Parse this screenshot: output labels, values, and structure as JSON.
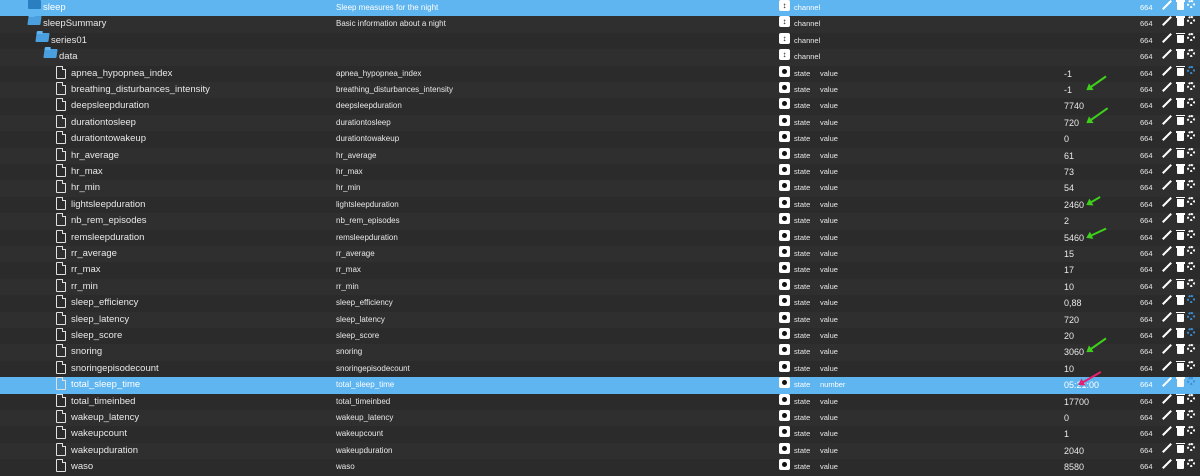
{
  "accent_color": "#5fb5f0",
  "annotation_colors": {
    "green": "#3ecf1a",
    "pink": "#e6206e"
  },
  "rows": [
    {
      "name": "sleep",
      "desc": "Sleep measures for the night",
      "role": "channel",
      "type": "",
      "common": "",
      "value": "",
      "acl": "664",
      "icon": "folder",
      "indent": 32,
      "selected": true
    },
    {
      "name": "sleepSummary",
      "desc": "Basic information about a night",
      "role": "channel",
      "type": "",
      "common": "",
      "value": "",
      "acl": "664",
      "icon": "folder-open",
      "indent": 32,
      "selected": false
    },
    {
      "name": "series01",
      "desc": "",
      "role": "channel",
      "type": "",
      "common": "",
      "value": "",
      "acl": "664",
      "icon": "folder-open",
      "indent": 40,
      "selected": false
    },
    {
      "name": "data",
      "desc": "",
      "role": "channel",
      "type": "",
      "common": "",
      "value": "",
      "acl": "664",
      "icon": "folder-open",
      "indent": 48,
      "selected": false
    },
    {
      "name": "apnea_hypopnea_index",
      "desc": "apnea_hypopnea_index",
      "role": "state",
      "type": "value",
      "common": "",
      "value": "-1",
      "acl": "664",
      "icon": "file",
      "indent": 56,
      "selected": false,
      "gear": "blue"
    },
    {
      "name": "breathing_disturbances_intensity",
      "desc": "breathing_disturbances_intensity",
      "role": "state",
      "type": "value",
      "common": "",
      "value": "-1",
      "acl": "664",
      "icon": "file",
      "indent": 56,
      "selected": false
    },
    {
      "name": "deepsleepduration",
      "desc": "deepsleepduration",
      "role": "state",
      "type": "value",
      "common": "",
      "value": "7740",
      "acl": "664",
      "icon": "file",
      "indent": 56,
      "selected": false
    },
    {
      "name": "durationtosleep",
      "desc": "durationtosleep",
      "role": "state",
      "type": "value",
      "common": "",
      "value": "720",
      "acl": "664",
      "icon": "file",
      "indent": 56,
      "selected": false
    },
    {
      "name": "durationtowakeup",
      "desc": "durationtowakeup",
      "role": "state",
      "type": "value",
      "common": "",
      "value": "0",
      "acl": "664",
      "icon": "file",
      "indent": 56,
      "selected": false
    },
    {
      "name": "hr_average",
      "desc": "hr_average",
      "role": "state",
      "type": "value",
      "common": "",
      "value": "61",
      "acl": "664",
      "icon": "file",
      "indent": 56,
      "selected": false
    },
    {
      "name": "hr_max",
      "desc": "hr_max",
      "role": "state",
      "type": "value",
      "common": "",
      "value": "73",
      "acl": "664",
      "icon": "file",
      "indent": 56,
      "selected": false
    },
    {
      "name": "hr_min",
      "desc": "hr_min",
      "role": "state",
      "type": "value",
      "common": "",
      "value": "54",
      "acl": "664",
      "icon": "file",
      "indent": 56,
      "selected": false
    },
    {
      "name": "lightsleepduration",
      "desc": "lightsleepduration",
      "role": "state",
      "type": "value",
      "common": "",
      "value": "2460",
      "acl": "664",
      "icon": "file",
      "indent": 56,
      "selected": false
    },
    {
      "name": "nb_rem_episodes",
      "desc": "nb_rem_episodes",
      "role": "state",
      "type": "value",
      "common": "",
      "value": "2",
      "acl": "664",
      "icon": "file",
      "indent": 56,
      "selected": false
    },
    {
      "name": "remsleepduration",
      "desc": "remsleepduration",
      "role": "state",
      "type": "value",
      "common": "",
      "value": "5460",
      "acl": "664",
      "icon": "file",
      "indent": 56,
      "selected": false
    },
    {
      "name": "rr_average",
      "desc": "rr_average",
      "role": "state",
      "type": "value",
      "common": "",
      "value": "15",
      "acl": "664",
      "icon": "file",
      "indent": 56,
      "selected": false
    },
    {
      "name": "rr_max",
      "desc": "rr_max",
      "role": "state",
      "type": "value",
      "common": "",
      "value": "17",
      "acl": "664",
      "icon": "file",
      "indent": 56,
      "selected": false
    },
    {
      "name": "rr_min",
      "desc": "rr_min",
      "role": "state",
      "type": "value",
      "common": "",
      "value": "10",
      "acl": "664",
      "icon": "file",
      "indent": 56,
      "selected": false
    },
    {
      "name": "sleep_efficiency",
      "desc": "sleep_efficiency",
      "role": "state",
      "type": "value",
      "common": "",
      "value": "0,88",
      "acl": "664",
      "icon": "file",
      "indent": 56,
      "selected": false,
      "gear": "blue"
    },
    {
      "name": "sleep_latency",
      "desc": "sleep_latency",
      "role": "state",
      "type": "value",
      "common": "",
      "value": "720",
      "acl": "664",
      "icon": "file",
      "indent": 56,
      "selected": false,
      "gear": "blue"
    },
    {
      "name": "sleep_score",
      "desc": "sleep_score",
      "role": "state",
      "type": "value",
      "common": "",
      "value": "20",
      "acl": "664",
      "icon": "file",
      "indent": 56,
      "selected": false,
      "gear": "blue"
    },
    {
      "name": "snoring",
      "desc": "snoring",
      "role": "state",
      "type": "value",
      "common": "",
      "value": "3060",
      "acl": "664",
      "icon": "file",
      "indent": 56,
      "selected": false
    },
    {
      "name": "snoringepisodecount",
      "desc": "snoringepisodecount",
      "role": "state",
      "type": "value",
      "common": "",
      "value": "10",
      "acl": "664",
      "icon": "file",
      "indent": 56,
      "selected": false
    },
    {
      "name": "total_sleep_time",
      "desc": "total_sleep_time",
      "role": "state",
      "type": "number",
      "common": "",
      "value": "05:21:00",
      "acl": "664",
      "icon": "file",
      "indent": 56,
      "selected": true,
      "gear": "blue"
    },
    {
      "name": "total_timeinbed",
      "desc": "total_timeinbed",
      "role": "state",
      "type": "value",
      "common": "",
      "value": "17700",
      "acl": "664",
      "icon": "file",
      "indent": 56,
      "selected": false
    },
    {
      "name": "wakeup_latency",
      "desc": "wakeup_latency",
      "role": "state",
      "type": "value",
      "common": "",
      "value": "0",
      "acl": "664",
      "icon": "file",
      "indent": 56,
      "selected": false
    },
    {
      "name": "wakeupcount",
      "desc": "wakeupcount",
      "role": "state",
      "type": "value",
      "common": "",
      "value": "1",
      "acl": "664",
      "icon": "file",
      "indent": 56,
      "selected": false
    },
    {
      "name": "wakeupduration",
      "desc": "wakeupduration",
      "role": "state",
      "type": "value",
      "common": "",
      "value": "2040",
      "acl": "664",
      "icon": "file",
      "indent": 56,
      "selected": false
    },
    {
      "name": "waso",
      "desc": "waso",
      "role": "state",
      "type": "value",
      "common": "",
      "value": "8580",
      "acl": "664",
      "icon": "file",
      "indent": 56,
      "selected": false
    }
  ]
}
